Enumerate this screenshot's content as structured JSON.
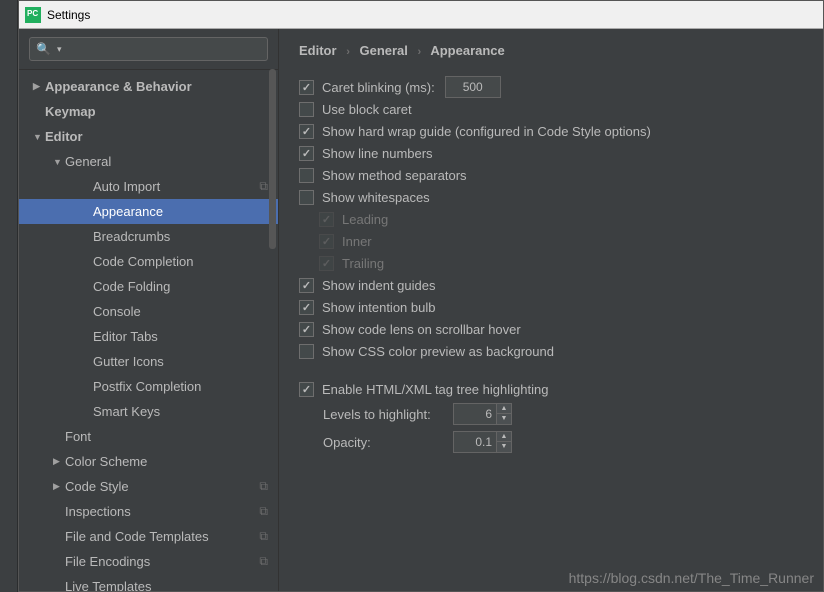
{
  "window": {
    "title": "Settings"
  },
  "search": {
    "placeholder": ""
  },
  "tree": [
    {
      "label": "Appearance & Behavior",
      "depth": 0,
      "bold": true,
      "arrow": "right",
      "badge": ""
    },
    {
      "label": "Keymap",
      "depth": 0,
      "bold": true,
      "arrow": "none",
      "badge": ""
    },
    {
      "label": "Editor",
      "depth": 0,
      "bold": true,
      "arrow": "down",
      "badge": ""
    },
    {
      "label": "General",
      "depth": 1,
      "bold": false,
      "arrow": "down",
      "badge": ""
    },
    {
      "label": "Auto Import",
      "depth": 2,
      "bold": false,
      "arrow": "none",
      "badge": "⧉"
    },
    {
      "label": "Appearance",
      "depth": 2,
      "bold": false,
      "arrow": "none",
      "badge": "",
      "selected": true
    },
    {
      "label": "Breadcrumbs",
      "depth": 2,
      "bold": false,
      "arrow": "none",
      "badge": ""
    },
    {
      "label": "Code Completion",
      "depth": 2,
      "bold": false,
      "arrow": "none",
      "badge": ""
    },
    {
      "label": "Code Folding",
      "depth": 2,
      "bold": false,
      "arrow": "none",
      "badge": ""
    },
    {
      "label": "Console",
      "depth": 2,
      "bold": false,
      "arrow": "none",
      "badge": ""
    },
    {
      "label": "Editor Tabs",
      "depth": 2,
      "bold": false,
      "arrow": "none",
      "badge": ""
    },
    {
      "label": "Gutter Icons",
      "depth": 2,
      "bold": false,
      "arrow": "none",
      "badge": ""
    },
    {
      "label": "Postfix Completion",
      "depth": 2,
      "bold": false,
      "arrow": "none",
      "badge": ""
    },
    {
      "label": "Smart Keys",
      "depth": 2,
      "bold": false,
      "arrow": "none",
      "badge": ""
    },
    {
      "label": "Font",
      "depth": 1,
      "bold": false,
      "arrow": "none",
      "badge": ""
    },
    {
      "label": "Color Scheme",
      "depth": 1,
      "bold": false,
      "arrow": "right",
      "badge": ""
    },
    {
      "label": "Code Style",
      "depth": 1,
      "bold": false,
      "arrow": "right",
      "badge": "⧉"
    },
    {
      "label": "Inspections",
      "depth": 1,
      "bold": false,
      "arrow": "none",
      "badge": "⧉"
    },
    {
      "label": "File and Code Templates",
      "depth": 1,
      "bold": false,
      "arrow": "none",
      "badge": "⧉"
    },
    {
      "label": "File Encodings",
      "depth": 1,
      "bold": false,
      "arrow": "none",
      "badge": "⧉"
    },
    {
      "label": "Live Templates",
      "depth": 1,
      "bold": false,
      "arrow": "none",
      "badge": ""
    }
  ],
  "crumb": {
    "a": "Editor",
    "b": "General",
    "c": "Appearance"
  },
  "opts": {
    "caret_blink": {
      "label": "Caret blinking (ms):",
      "checked": true,
      "value": "500"
    },
    "block_caret": {
      "label": "Use block caret",
      "checked": false
    },
    "hard_wrap": {
      "label": "Show hard wrap guide (configured in Code Style options)",
      "checked": true
    },
    "line_numbers": {
      "label": "Show line numbers",
      "checked": true
    },
    "method_sep": {
      "label": "Show method separators",
      "checked": false
    },
    "whitespace": {
      "label": "Show whitespaces",
      "checked": false
    },
    "ws_leading": {
      "label": "Leading",
      "checked": true
    },
    "ws_inner": {
      "label": "Inner",
      "checked": true
    },
    "ws_trailing": {
      "label": "Trailing",
      "checked": true
    },
    "indent_guides": {
      "label": "Show indent guides",
      "checked": true
    },
    "intention_bulb": {
      "label": "Show intention bulb",
      "checked": true
    },
    "code_lens": {
      "label": "Show code lens on scrollbar hover",
      "checked": true
    },
    "css_preview": {
      "label": "Show CSS color preview as background",
      "checked": false
    },
    "tag_tree": {
      "label": "Enable HTML/XML tag tree highlighting",
      "checked": true
    },
    "levels": {
      "label": "Levels to highlight:",
      "value": "6"
    },
    "opacity": {
      "label": "Opacity:",
      "value": "0.1"
    }
  },
  "watermark": "https://blog.csdn.net/The_Time_Runner"
}
